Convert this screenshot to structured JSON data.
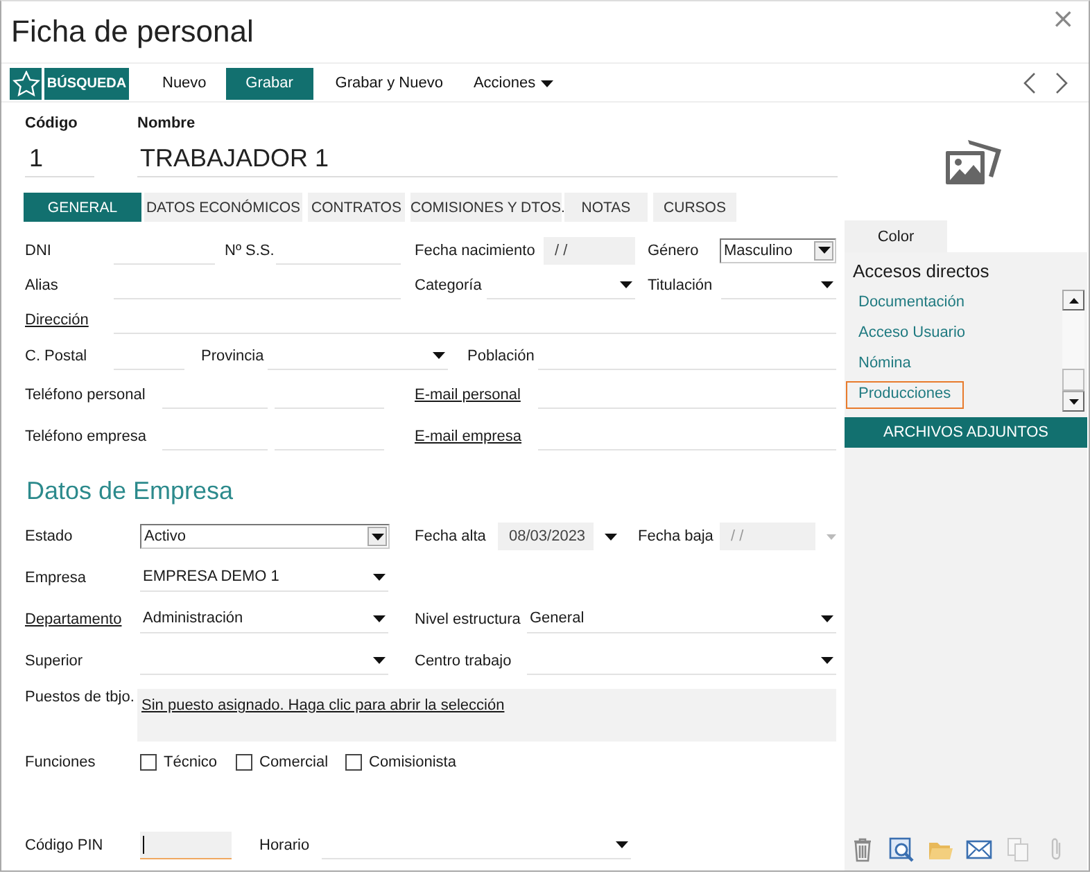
{
  "window": {
    "title": "Ficha de personal",
    "close": "×"
  },
  "toolbar": {
    "buttons": [
      {
        "kind": "favorite"
      },
      {
        "kind": "search",
        "label": "BÚSQUEDA"
      },
      {
        "kind": "plain",
        "label": "Nuevo"
      },
      {
        "kind": "primary",
        "label": "Grabar"
      },
      {
        "kind": "plain",
        "label": "Grabar y Nuevo"
      },
      {
        "kind": "menu",
        "label": "Acciones"
      }
    ],
    "nav": [
      {
        "kind": "previous"
      },
      {
        "kind": "next"
      }
    ]
  },
  "header": {
    "code": {
      "label": "Código",
      "value": "1"
    },
    "name": {
      "label": "Nombre",
      "value": "TRABAJADOR 1"
    }
  },
  "tabs": [
    {
      "label": "GENERAL",
      "selected": true
    },
    {
      "label": "DATOS ECONÓMICOS",
      "selected": false
    },
    {
      "label": "CONTRATOS",
      "selected": false
    },
    {
      "label": "COMISIONES Y DTOS.",
      "selected": false
    },
    {
      "label": "NOTAS",
      "selected": false
    },
    {
      "label": "CURSOS",
      "selected": false
    }
  ],
  "general": {
    "dni": {
      "label": {
        "text": "DNI",
        "link": false
      },
      "fields": [
        {
          "kind": "text"
        }
      ]
    },
    "nss": {
      "label": {
        "text": "Nº S.S.",
        "link": false
      },
      "fields": [
        {
          "kind": "text"
        }
      ]
    },
    "fecha_nacimiento": {
      "label": {
        "text": "Fecha nacimiento",
        "link": false
      },
      "fields": [
        {
          "kind": "date",
          "value": "/ /"
        }
      ]
    },
    "genero": {
      "label": {
        "text": "Género",
        "link": false
      },
      "fields": [
        {
          "kind": "select",
          "value": "Masculino"
        }
      ]
    },
    "alias": {
      "label": {
        "text": "Alias",
        "link": false
      },
      "fields": [
        {
          "kind": "text"
        }
      ]
    },
    "categoria": {
      "label": {
        "text": "Categoría",
        "link": false
      },
      "fields": [
        {
          "kind": "combo"
        }
      ]
    },
    "titulacion": {
      "label": {
        "text": "Titulación",
        "link": false
      },
      "fields": [
        {
          "kind": "combo"
        }
      ]
    },
    "direccion": {
      "label": {
        "text": "Dirección",
        "link": true
      },
      "fields": [
        {
          "kind": "text"
        }
      ]
    },
    "codigo_postal": {
      "label": {
        "text": "C. Postal",
        "link": false
      },
      "fields": [
        {
          "kind": "text"
        }
      ]
    },
    "provincia": {
      "label": {
        "text": "Provincia",
        "link": false
      },
      "fields": [
        {
          "kind": "combo"
        }
      ]
    },
    "poblacion": {
      "label": {
        "text": "Población",
        "link": false
      },
      "fields": [
        {
          "kind": "text"
        }
      ]
    },
    "telefono_personal": {
      "label": {
        "text": "Teléfono personal",
        "link": false
      },
      "fields": [
        {
          "kind": "text"
        },
        {
          "kind": "text"
        }
      ]
    },
    "email_personal": {
      "label": {
        "text": "E-mail personal",
        "link": true
      },
      "fields": [
        {
          "kind": "text"
        }
      ]
    },
    "telefono_empresa": {
      "label": {
        "text": "Teléfono empresa",
        "link": false
      },
      "fields": [
        {
          "kind": "text"
        },
        {
          "kind": "text"
        }
      ]
    },
    "email_empresa": {
      "label": {
        "text": "E-mail empresa",
        "link": true
      },
      "fields": [
        {
          "kind": "text"
        }
      ]
    }
  },
  "empresa": {
    "heading": "Datos de Empresa",
    "rows": [
      [
        {
          "kind": "label",
          "text": "Estado",
          "link": false
        },
        {
          "kind": "select",
          "value": "Activo"
        },
        {
          "kind": "label",
          "text": "Fecha alta",
          "link": false
        },
        {
          "kind": "date-picker",
          "value": "08/03/2023",
          "disabled": false
        },
        {
          "kind": "label",
          "text": "Fecha baja",
          "link": false
        },
        {
          "kind": "date-picker",
          "value": "/ /",
          "disabled": true
        }
      ],
      [
        {
          "kind": "label",
          "text": "Empresa",
          "link": false
        },
        {
          "kind": "combo",
          "value": "EMPRESA DEMO 1"
        }
      ],
      [
        {
          "kind": "label",
          "text": "Departamento",
          "link": true
        },
        {
          "kind": "combo",
          "value": "Administración"
        },
        {
          "kind": "label",
          "text": "Nivel estructura",
          "link": false
        },
        {
          "kind": "combo",
          "value": "General"
        }
      ],
      [
        {
          "kind": "label",
          "text": "Superior",
          "link": false
        },
        {
          "kind": "combo"
        },
        {
          "kind": "label",
          "text": "Centro trabajo",
          "link": false
        },
        {
          "kind": "combo"
        }
      ],
      [
        {
          "kind": "label",
          "text": "Puestos de tbjo.",
          "link": false
        },
        {
          "kind": "area",
          "link": "Sin puesto asignado. Haga clic para abrir la selección"
        }
      ],
      [
        {
          "kind": "label",
          "text": "Funciones",
          "link": false
        },
        {
          "kind": "checkbox",
          "text": "Técnico",
          "checked": false
        },
        {
          "kind": "checkbox",
          "text": "Comercial",
          "checked": false
        },
        {
          "kind": "checkbox",
          "text": "Comisionista",
          "checked": false
        }
      ],
      [
        {
          "kind": "label",
          "text": "Código PIN",
          "link": false
        },
        {
          "kind": "text",
          "focused": true
        },
        {
          "kind": "label",
          "text": "Horario",
          "link": false
        },
        {
          "kind": "combo"
        }
      ]
    ]
  },
  "side": {
    "color_tab": "Color",
    "shortcuts": {
      "title": "Accesos directos",
      "items": [
        {
          "label": "Documentación",
          "selected": false
        },
        {
          "label": "Acceso Usuario",
          "selected": false
        },
        {
          "label": "Nómina",
          "selected": false
        },
        {
          "label": "Producciones",
          "selected": true
        }
      ]
    },
    "attachments": {
      "title": "ARCHIVOS ADJUNTOS",
      "actions": [
        {
          "kind": "delete",
          "disabled": false
        },
        {
          "kind": "preview",
          "disabled": false
        },
        {
          "kind": "folder",
          "disabled": false
        },
        {
          "kind": "mail",
          "disabled": false
        },
        {
          "kind": "copy",
          "disabled": true
        },
        {
          "kind": "clip",
          "disabled": true
        }
      ]
    }
  }
}
